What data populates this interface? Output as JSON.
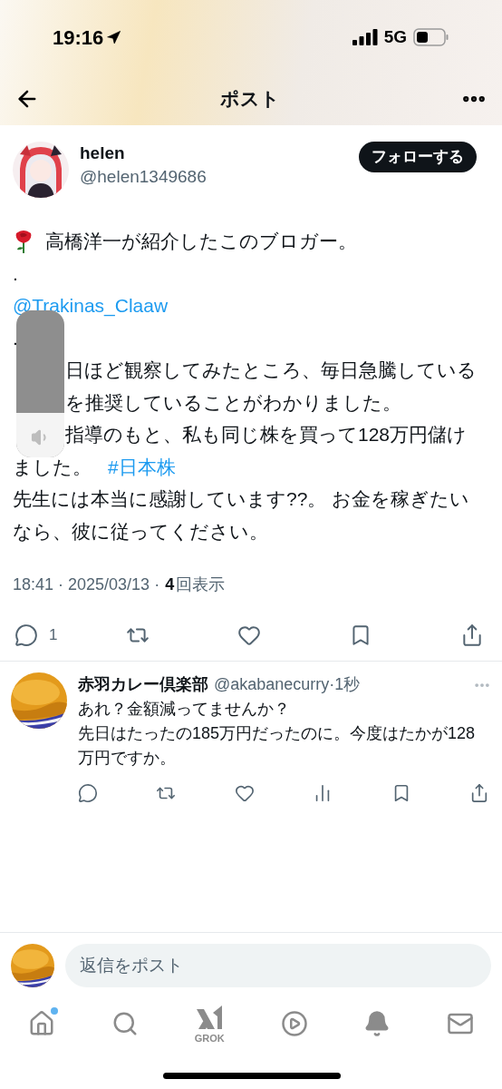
{
  "status_bar": {
    "time": "19:16",
    "network": "5G"
  },
  "header": {
    "title": "ポスト"
  },
  "author": {
    "name": "helen",
    "handle": "@helen1349686",
    "follow_button": "フォローする"
  },
  "post": {
    "lines": [
      {
        "kind": "rose",
        "text": "高橋洋一が紹介したこのブロガー。"
      },
      {
        "kind": "text",
        "text": "."
      },
      {
        "kind": "link",
        "text": "@Trakinas_Claaw"
      },
      {
        "kind": "text",
        "text": "."
      },
      {
        "kind": "covered",
        "text": "日ほど観察してみたところ、毎日急騰している"
      },
      {
        "kind": "covered",
        "text": "を推奨していることがわかりました。"
      },
      {
        "kind": "covered",
        "text": "指導のもと、私も同じ株を買って128万円儲け"
      },
      {
        "kind": "tag",
        "text": "ました。",
        "tag": "#日本株"
      },
      {
        "kind": "text",
        "text": "先生には本当に感謝しています??。 お金を稼ぎたいなら、彼に従ってください。"
      }
    ],
    "timestamp": "18:41 · 2025/03/13 ·",
    "view_count": "4",
    "view_label": "回表示",
    "actions": [
      {
        "kind": "reply",
        "count": "1"
      },
      {
        "kind": "repost"
      },
      {
        "kind": "like"
      },
      {
        "kind": "bookmark"
      },
      {
        "kind": "share"
      }
    ]
  },
  "volume_hud": {
    "level": 0.3
  },
  "reply": {
    "name": "赤羽カレー倶楽部",
    "handle": "@akabanecurry",
    "time": "·1秒",
    "lines": [
      "あれ？金額減ってませんか？",
      "先日はたったの185万円だったのに。今度はたかが128万円ですか。"
    ],
    "actions": [
      {
        "kind": "reply"
      },
      {
        "kind": "repost"
      },
      {
        "kind": "like"
      },
      {
        "kind": "views"
      },
      {
        "kind": "bookmark"
      },
      {
        "kind": "share"
      }
    ]
  },
  "compose": {
    "placeholder": "返信をポスト"
  },
  "nav": [
    {
      "kind": "home",
      "badge": true
    },
    {
      "kind": "search"
    },
    {
      "kind": "grok",
      "label": "GROK"
    },
    {
      "kind": "video"
    },
    {
      "kind": "notifications"
    },
    {
      "kind": "messages"
    }
  ]
}
